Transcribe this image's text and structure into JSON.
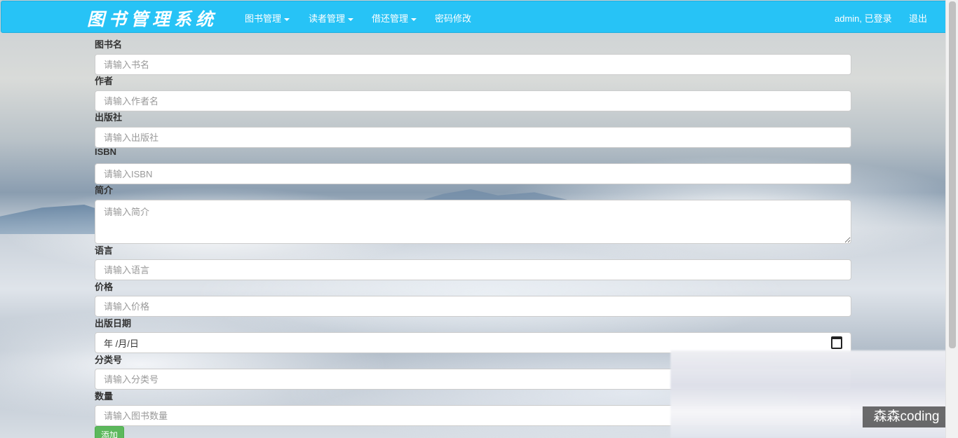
{
  "navbar": {
    "brand": "图书管理系统",
    "menu": [
      {
        "label": "图书管理",
        "dropdown": true
      },
      {
        "label": "读者管理",
        "dropdown": true
      },
      {
        "label": "借还管理",
        "dropdown": true
      },
      {
        "label": "密码修改",
        "dropdown": false
      }
    ],
    "user_status": "admin, 已登录",
    "logout": "退出"
  },
  "form": {
    "fields": [
      {
        "label": "图书名",
        "placeholder": "请输入书名"
      },
      {
        "label": "作者",
        "placeholder": "请输入作者名"
      },
      {
        "label": "出版社",
        "placeholder": "请输入出版社"
      },
      {
        "label": "ISBN",
        "placeholder": "请输入ISBN"
      },
      {
        "label": "简介",
        "placeholder": "请输入简介"
      },
      {
        "label": "语言",
        "placeholder": "请输入语言"
      },
      {
        "label": "价格",
        "placeholder": "请输入价格"
      },
      {
        "label": "出版日期",
        "value": "年 /月/日"
      },
      {
        "label": "分类号",
        "placeholder": "请输入分类号"
      },
      {
        "label": "数量",
        "placeholder": "请输入图书数量"
      }
    ],
    "submit_label": "添加"
  },
  "watermark": "森森coding",
  "colors": {
    "navbar": "#27c3f6",
    "submit": "#5cb85c"
  }
}
